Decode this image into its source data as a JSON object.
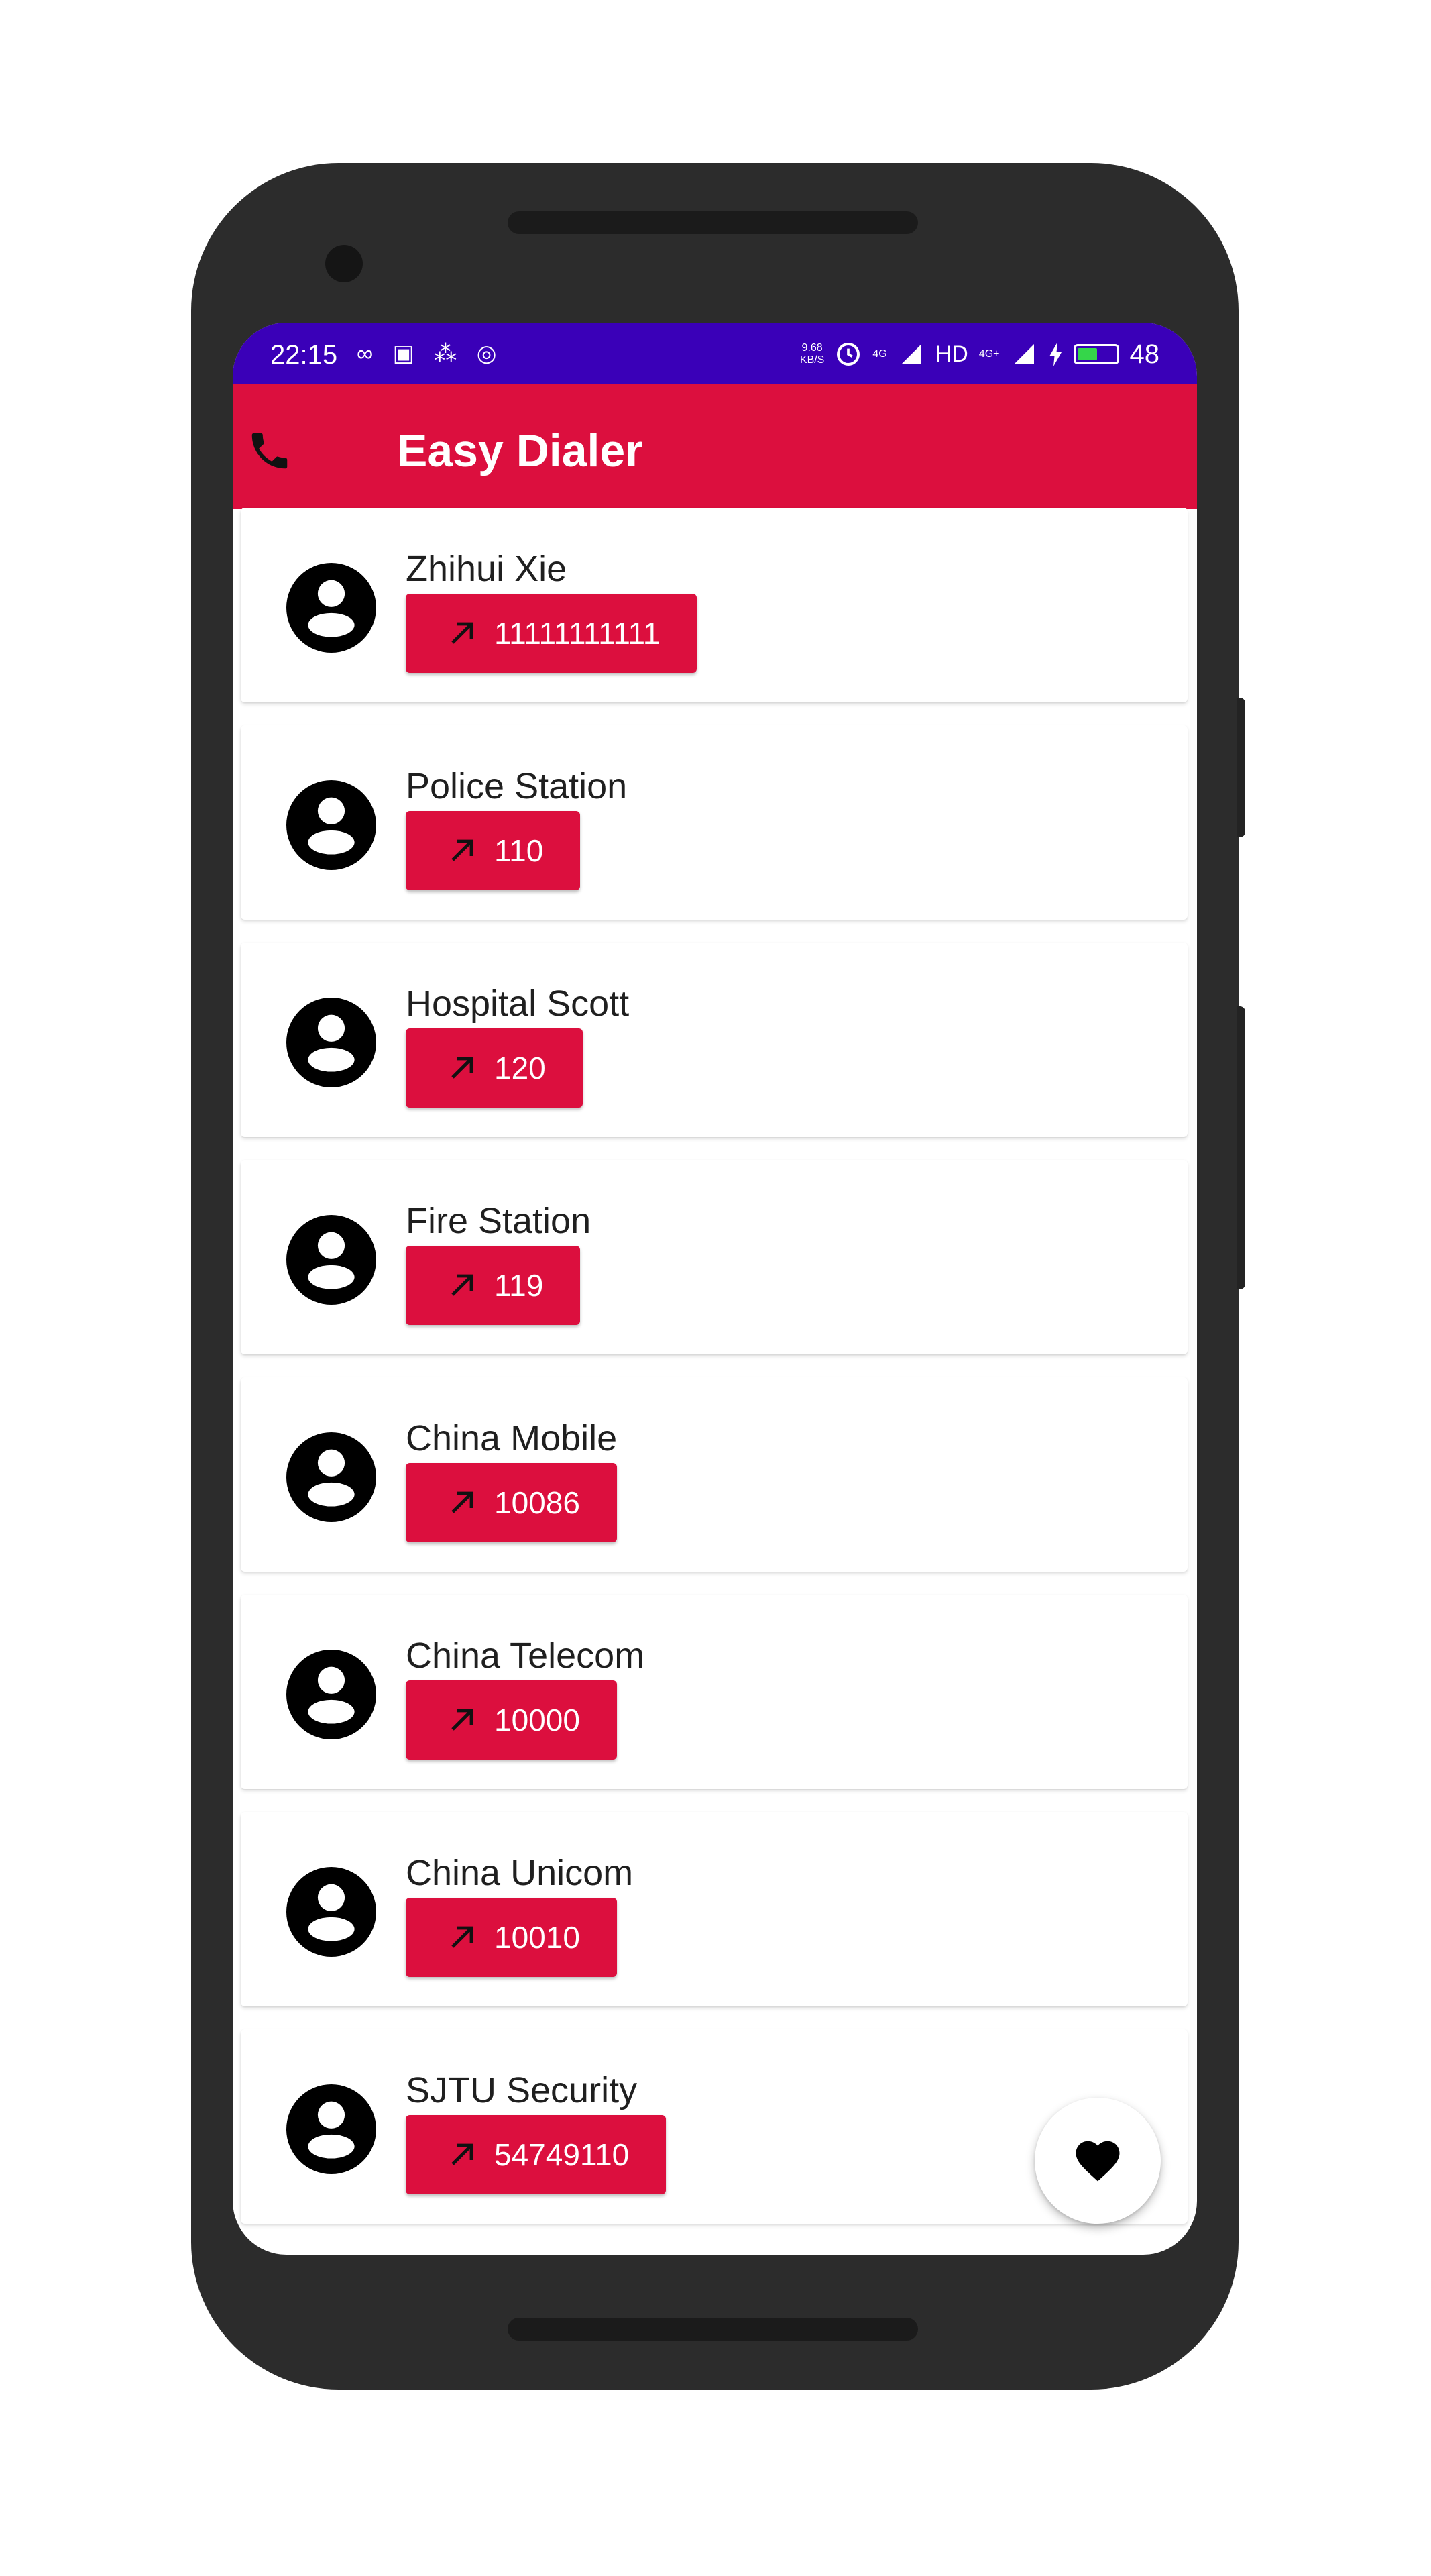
{
  "status_bar": {
    "time": "22:15",
    "left_icons": "∞ ▣ ⁂ ◎",
    "net_speed_value": "9.68",
    "net_speed_unit": "KB/S",
    "network_4g": "4G",
    "hd_label": "HD",
    "network_4g_plus": "4G+",
    "battery_level": "48"
  },
  "app_bar": {
    "title": "Easy Dialer",
    "icon": "phone-icon"
  },
  "contacts": [
    {
      "name": "Zhihui Xie",
      "number": "11111111111"
    },
    {
      "name": "Police Station",
      "number": "110"
    },
    {
      "name": "Hospital Scott",
      "number": "120"
    },
    {
      "name": "Fire Station",
      "number": "119"
    },
    {
      "name": "China Mobile",
      "number": "10086"
    },
    {
      "name": "China Telecom",
      "number": "10000"
    },
    {
      "name": "China Unicom",
      "number": "10010"
    },
    {
      "name": "SJTU Security",
      "number": "54749110"
    }
  ],
  "fab": {
    "icon": "heart-icon"
  },
  "colors": {
    "status_bar": "#3a00b8",
    "app_bar": "#dc0f3e",
    "button": "#dc0f3e",
    "phone_body": "#2c2c2c"
  }
}
